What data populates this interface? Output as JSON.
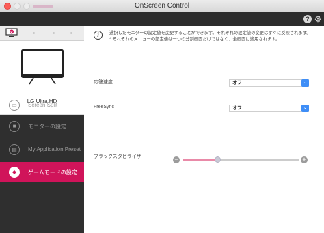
{
  "window": {
    "title": "OnScreen Control"
  },
  "topbar": {
    "help_label": "?"
  },
  "sidebar": {
    "monitor_name": "LG Ultra HD",
    "items": [
      {
        "label": "Screen Split",
        "icon": "screen-split-icon",
        "active": false
      },
      {
        "label": "モニターの設定",
        "icon": "monitor-settings-icon",
        "active": false
      },
      {
        "label": "My Application Preset",
        "icon": "app-preset-icon",
        "active": false
      },
      {
        "label": "ゲームモードの設定",
        "icon": "gamepad-icon",
        "active": true
      }
    ]
  },
  "main": {
    "info_line1": "選択したモニターの設定値を変更することができます。それぞれの設定値の変更はすぐに反映されます。",
    "info_line2": "* それぞれのメニューの設定値は一つの分割画面だけではなく、全画面に適用されます。",
    "settings": {
      "response_time": {
        "label": "応答速度",
        "value": "オフ"
      },
      "freesync": {
        "label": "FreeSync",
        "value": "オフ"
      },
      "black_stabilizer": {
        "label": "ブラックスタビライザー",
        "level": 0.3
      }
    }
  },
  "colors": {
    "accent": "#d0145a",
    "select_caret": "#3e8ef7"
  }
}
